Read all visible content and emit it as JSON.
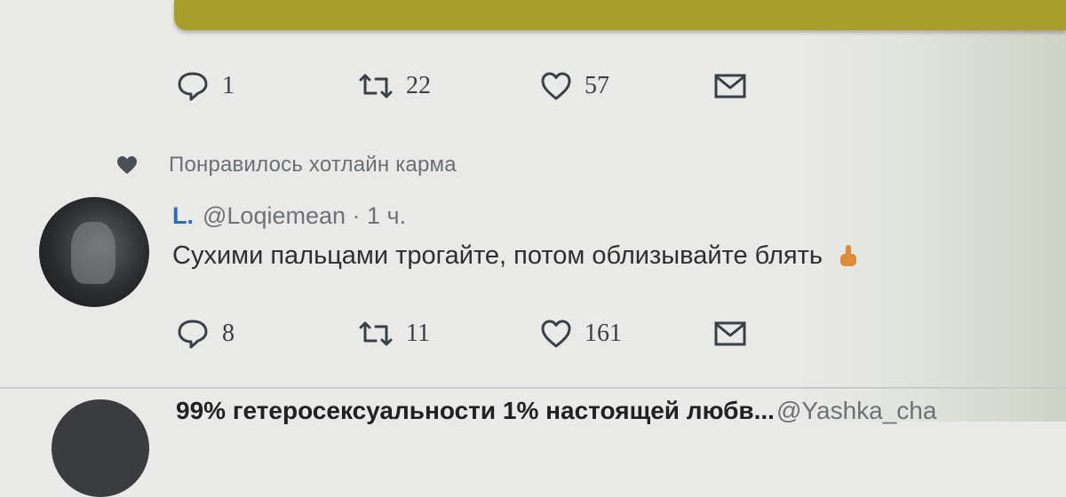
{
  "previous_tweet": {
    "reply_count": "1",
    "retweet_count": "22",
    "like_count": "57"
  },
  "liked_line": {
    "text": "Понравилось хотлайн карма"
  },
  "tweet": {
    "name": "L.",
    "meta": "@Loqiemean · 1 ч.",
    "text": "Сухими пальцами трогайте, потом облизывайте блять",
    "reply_count": "8",
    "retweet_count": "11",
    "like_count": "161"
  },
  "next_tweet": {
    "title": "99% гетеросексуальности 1% настоящей любв...",
    "user": "@Yashka_cha"
  },
  "colors": {
    "media_strip": "#a79f2a",
    "name_link": "#2c6db3",
    "emoji": "#e08a3c"
  },
  "icons": [
    "reply-icon",
    "retweet-icon",
    "like-icon",
    "direct-message-icon",
    "liked-heart-icon",
    "pointing-finger-emoji"
  ]
}
